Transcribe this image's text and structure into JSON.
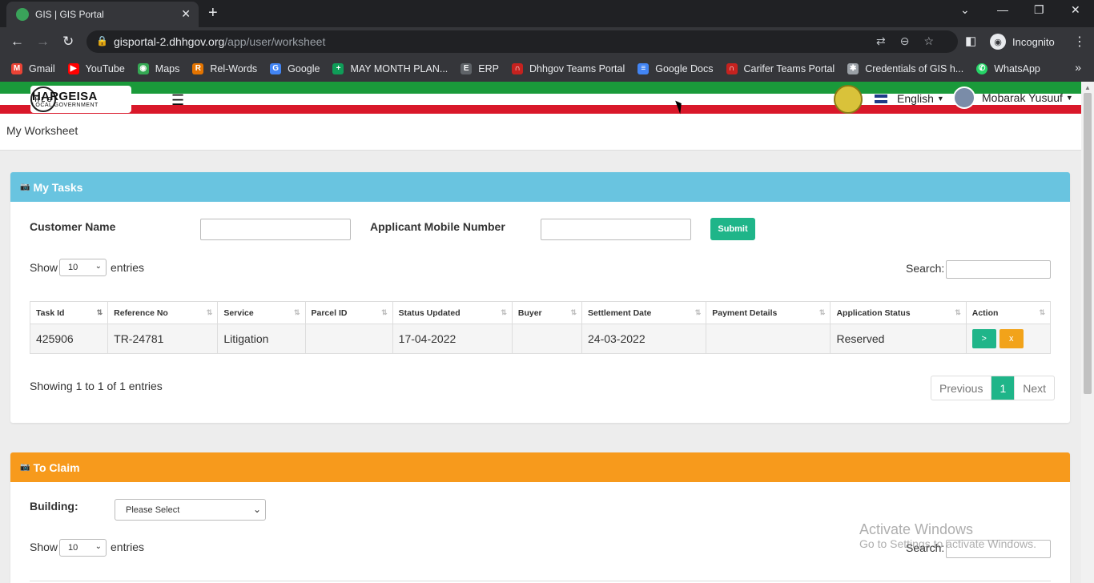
{
  "browser": {
    "tab_title": "GIS | GIS Portal",
    "url_host": "gisportal-2.dhhgov.org",
    "url_path": "/app/user/worksheet",
    "incognito_label": "Incognito",
    "bookmarks": [
      {
        "label": "Gmail",
        "color": "#ea4335"
      },
      {
        "label": "YouTube",
        "color": "#ff0000"
      },
      {
        "label": "Maps",
        "color": "#34a853"
      },
      {
        "label": "Rel-Words",
        "color": "#e37400"
      },
      {
        "label": "Google",
        "color": "#4285f4"
      },
      {
        "label": "MAY MONTH PLAN...",
        "color": "#0f9d58"
      },
      {
        "label": "ERP",
        "color": "#5f6368"
      },
      {
        "label": "Dhhgov Teams Portal",
        "color": "#c5221f"
      },
      {
        "label": "Google Docs",
        "color": "#4285f4"
      },
      {
        "label": "Carifer Teams Portal",
        "color": "#c5221f"
      },
      {
        "label": "Credentials of GIS h...",
        "color": "#9aa0a6"
      },
      {
        "label": "WhatsApp",
        "color": "#25d366"
      }
    ]
  },
  "header": {
    "logo_title": "HARGEISA",
    "logo_subtitle": "LOCAL GOVERNMENT",
    "logo_seal": "H L G",
    "language": "English",
    "user_name": "Mobarak Yusuuf"
  },
  "page": {
    "title": "My Worksheet"
  },
  "my_tasks": {
    "title": "My Tasks",
    "header_color": "#69c4e0",
    "customer_name_label": "Customer Name",
    "customer_name_value": "",
    "mobile_label": "Applicant Mobile Number",
    "mobile_value": "",
    "submit_label": "Submit",
    "show_label": "Show",
    "entries_value": "10",
    "entries_label": "entries",
    "search_label": "Search:",
    "columns": [
      "Task Id",
      "Reference No",
      "Service",
      "Parcel ID",
      "Status Updated",
      "Buyer",
      "Settlement Date",
      "Payment Details",
      "Application Status",
      "Action"
    ],
    "rows": [
      {
        "task_id": "425906",
        "reference_no": "TR-24781",
        "service": "Litigation",
        "parcel_id": "",
        "status_updated": "17-04-2022",
        "buyer": "",
        "settlement_date": "24-03-2022",
        "payment_details": "",
        "application_status": "Reserved",
        "action_go": ">",
        "action_x": "x"
      }
    ],
    "showing_text": "Showing 1 to 1 of 1 entries",
    "pager": {
      "previous": "Previous",
      "current": "1",
      "next": "Next"
    }
  },
  "to_claim": {
    "title": "To Claim",
    "header_color": "#f79a1c",
    "building_label": "Building:",
    "building_select": "Please Select",
    "show_label": "Show",
    "entries_value": "10",
    "entries_label": "entries",
    "search_label": "Search:"
  },
  "watermark": {
    "line1": "Activate Windows",
    "line2": "Go to Settings to activate Windows."
  }
}
